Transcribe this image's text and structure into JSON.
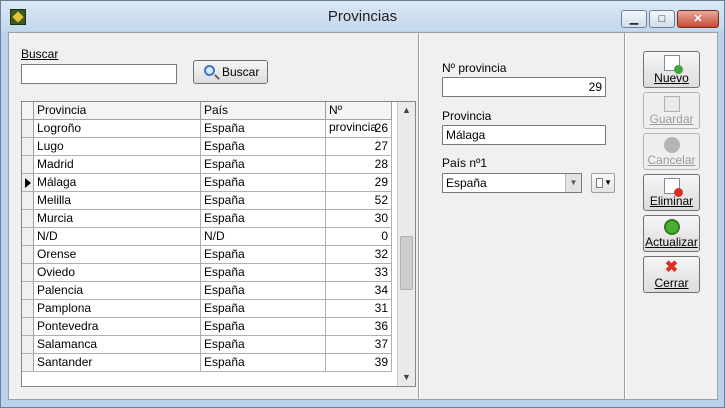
{
  "window": {
    "title": "Provincias",
    "minimize_glyph": "▁",
    "maximize_glyph": "□",
    "close_glyph": "✕"
  },
  "search": {
    "label": "Buscar",
    "value": "",
    "button_label": "Buscar"
  },
  "grid": {
    "columns": [
      "Provincia",
      "País",
      "Nº provincia"
    ],
    "current_row": 3,
    "rows": [
      {
        "provincia": "Logroño",
        "pais": "España",
        "num": "26"
      },
      {
        "provincia": "Lugo",
        "pais": "España",
        "num": "27"
      },
      {
        "provincia": "Madrid",
        "pais": "España",
        "num": "28"
      },
      {
        "provincia": "Málaga",
        "pais": "España",
        "num": "29"
      },
      {
        "provincia": "Melilla",
        "pais": "España",
        "num": "52"
      },
      {
        "provincia": "Murcia",
        "pais": "España",
        "num": "30"
      },
      {
        "provincia": "N/D",
        "pais": "N/D",
        "num": "0"
      },
      {
        "provincia": "Orense",
        "pais": "España",
        "num": "32"
      },
      {
        "provincia": "Oviedo",
        "pais": "España",
        "num": "33"
      },
      {
        "provincia": "Palencia",
        "pais": "España",
        "num": "34"
      },
      {
        "provincia": "Pamplona",
        "pais": "España",
        "num": "31"
      },
      {
        "provincia": "Pontevedra",
        "pais": "España",
        "num": "36"
      },
      {
        "provincia": "Salamanca",
        "pais": "España",
        "num": "37"
      },
      {
        "provincia": "Santander",
        "pais": "España",
        "num": "39"
      }
    ]
  },
  "detail": {
    "num_label": "Nº provincia",
    "num_value": "29",
    "provincia_label": "Provincia",
    "provincia_value": "Málaga",
    "pais_label": "País nº1",
    "pais_value": "España"
  },
  "actions": {
    "nuevo": "Nuevo",
    "guardar": "Guardar",
    "cancelar": "Cancelar",
    "eliminar": "Eliminar",
    "actualizar": "Actualizar",
    "cerrar": "Cerrar"
  },
  "icons": {
    "app": "app-icon",
    "search": "magnifier-icon",
    "nuevo": "new-document-icon",
    "guardar": "save-document-icon",
    "cancelar": "cancel-circle-icon",
    "eliminar": "delete-document-icon",
    "actualizar": "refresh-icon",
    "cerrar": "close-x-icon"
  },
  "colors": {
    "title_bar": "#c4d7ec",
    "selection_indicator": "#000000",
    "disabled_text": "#9b9b9b"
  }
}
